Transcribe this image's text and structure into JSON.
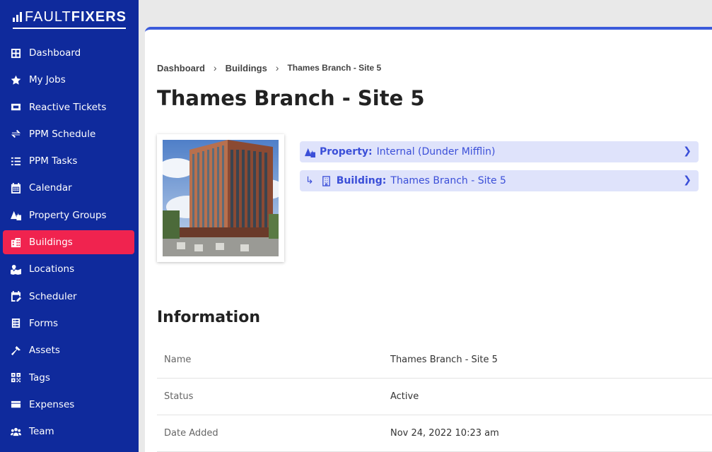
{
  "brand": {
    "logo_light": "FAULT",
    "logo_bold": "FIXERS"
  },
  "sidebar": {
    "items": [
      {
        "label": "Dashboard",
        "icon": "grid-icon"
      },
      {
        "label": "My Jobs",
        "icon": "star-icon"
      },
      {
        "label": "Reactive Tickets",
        "icon": "ticket-icon"
      },
      {
        "label": "PPM Schedule",
        "icon": "repeat-icon"
      },
      {
        "label": "PPM Tasks",
        "icon": "task-list-icon"
      },
      {
        "label": "Calendar",
        "icon": "calendar-icon"
      },
      {
        "label": "Property Groups",
        "icon": "property-group-icon"
      },
      {
        "label": "Buildings",
        "icon": "building-icon",
        "active": true
      },
      {
        "label": "Locations",
        "icon": "map-location-icon"
      },
      {
        "label": "Scheduler",
        "icon": "calendar-edit-icon"
      },
      {
        "label": "Forms",
        "icon": "form-icon"
      },
      {
        "label": "Assets",
        "icon": "hammer-icon"
      },
      {
        "label": "Tags",
        "icon": "qr-tag-icon"
      },
      {
        "label": "Expenses",
        "icon": "wallet-icon"
      },
      {
        "label": "Team",
        "icon": "team-icon"
      }
    ]
  },
  "breadcrumb": {
    "items": [
      "Dashboard",
      "Buildings"
    ],
    "current": "Thames Branch - Site 5"
  },
  "page": {
    "title": "Thames Branch - Site 5"
  },
  "relations": {
    "property": {
      "label": "Property:",
      "value": "Internal (Dunder Mifflin)"
    },
    "building": {
      "label": "Building:",
      "value": "Thames Branch - Site 5"
    }
  },
  "information": {
    "title": "Information",
    "rows": [
      {
        "key": "Name",
        "value": "Thames Branch - Site 5"
      },
      {
        "key": "Status",
        "value": "Active"
      },
      {
        "key": "Date Added",
        "value": "Nov 24, 2022 10:23 am"
      }
    ]
  },
  "colors": {
    "sidebar_bg": "#0f2a9c",
    "active_item": "#f0234f",
    "accent": "#3b5bdb",
    "link_row_bg": "#dfe3fb",
    "link_text": "#3b4fd8"
  }
}
